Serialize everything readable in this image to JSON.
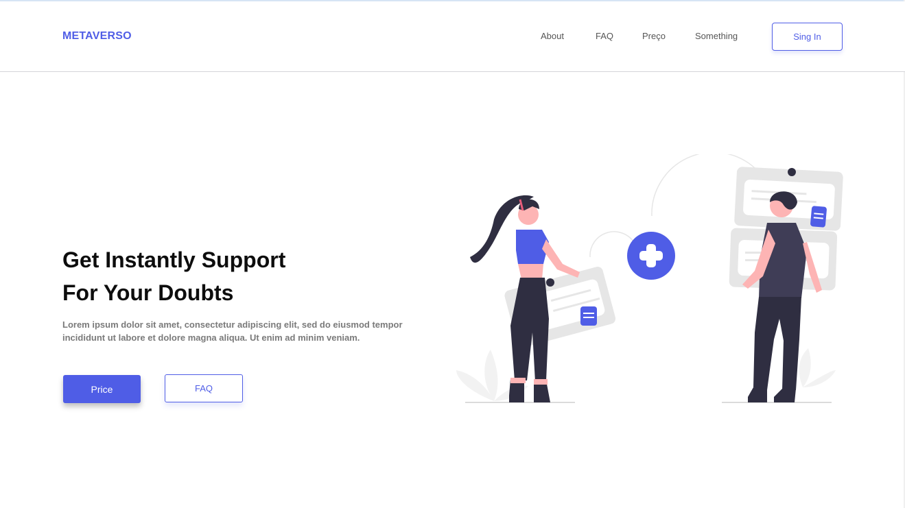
{
  "brand": {
    "name": "METAVERSO"
  },
  "nav": {
    "links": [
      {
        "label": "About"
      },
      {
        "label": "FAQ"
      },
      {
        "label": "Preço"
      },
      {
        "label": "Something"
      }
    ],
    "signin_label": "Sing In"
  },
  "hero": {
    "title_line1": "Get Instantly Support",
    "title_line2": "For Your Doubts",
    "body": "Lorem ipsum dolor sit amet, consectetur adipiscing elit, sed do eiusmod tempor incididunt ut labore et dolore magna aliqua. Ut enim ad minim veniam.",
    "primary_button": "Price",
    "secondary_button": "FAQ"
  },
  "illustration": {
    "icon": "plus-icon",
    "description_icons": [
      "woman-figure",
      "man-figure",
      "message-card",
      "document-icon"
    ]
  },
  "colors": {
    "accent": "#4f5de6",
    "dark": "#2f2e41",
    "skin": "#fdb4b4",
    "card": "#e6e6e6"
  }
}
